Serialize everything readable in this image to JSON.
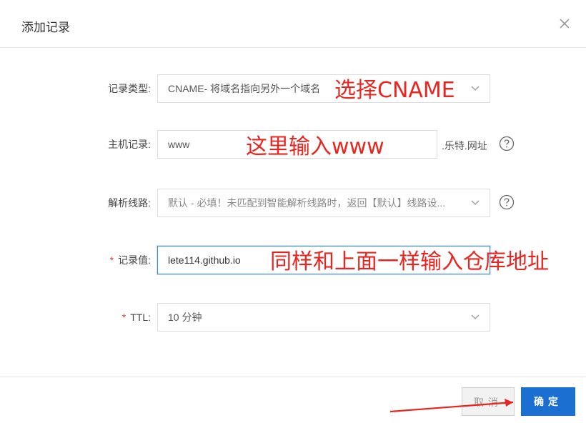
{
  "dialog": {
    "title": "添加记录",
    "close_icon": "close-icon"
  },
  "form": {
    "record_type": {
      "label": "记录类型:",
      "value": "CNAME- 将域名指向另外一个域名",
      "annotation": "选择CNAME"
    },
    "host_record": {
      "label": "主机记录:",
      "value": "www",
      "suffix": ".乐特.网址",
      "annotation": "这里输入www"
    },
    "resolution_line": {
      "label": "解析线路:",
      "value": "默认 - 必填！未匹配到智能解析线路时，返回【默认】线路设..."
    },
    "record_value": {
      "required_mark": "*",
      "label": "记录值:",
      "value": "lete114.github.io",
      "annotation": "同样和上面一样输入仓库地址"
    },
    "ttl": {
      "required_mark": "*",
      "label": "TTL:",
      "value": "10 分钟"
    }
  },
  "footer": {
    "cancel_label": "取消",
    "confirm_label": "确定"
  },
  "colors": {
    "primary": "#1a6fd1",
    "annotation": "#e8251f",
    "focus_border": "#3b8de0"
  }
}
